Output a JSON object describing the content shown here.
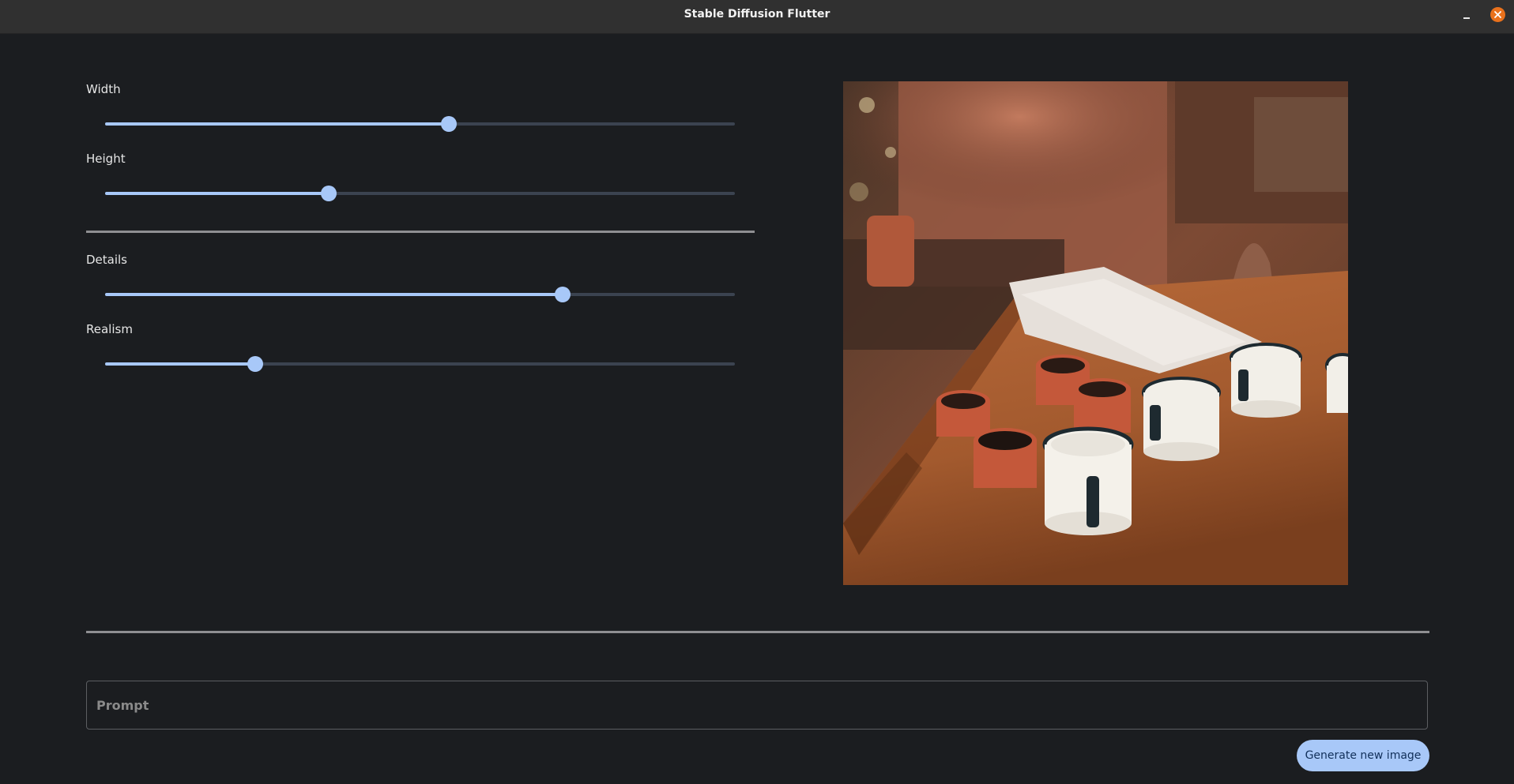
{
  "window": {
    "title": "Stable Diffusion Flutter"
  },
  "sliders": [
    {
      "label": "Width",
      "value": 0.546
    },
    {
      "label": "Height",
      "value": 0.355
    },
    {
      "label": "Details",
      "value": 0.726
    },
    {
      "label": "Realism",
      "value": 0.239
    }
  ],
  "image": {
    "subject": "enamel-cups-on-wooden-table"
  },
  "prompt": {
    "value": "",
    "placeholder": "Prompt"
  },
  "actions": {
    "generate_label": "Generate new image"
  },
  "colors": {
    "background": "#1b1d20",
    "titlebar": "#303030",
    "accent": "#a8c8f8",
    "track_inactive": "#3b4350",
    "close_button": "#e9711c",
    "divider": "#8f8f92"
  },
  "icons": {
    "minimize": "minimize-icon",
    "close": "close-icon"
  }
}
